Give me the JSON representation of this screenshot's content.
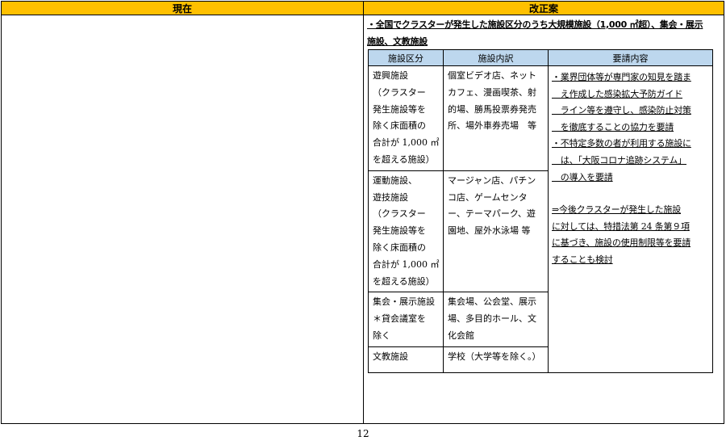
{
  "header": {
    "current_label": "現在",
    "proposal_label": "改正案"
  },
  "proposal": {
    "intro_line1": "・全国でクラスターが発生した施設区分のうち大規模施設（1,000 ㎡超）、集会・展示",
    "intro_line2": "施設、文教施設",
    "table": {
      "columns": [
        "施設区分",
        "施設内訳",
        "要請内容"
      ],
      "rows": [
        {
          "category_lines": [
            "遊興施設",
            "（クラスター",
            "発生施設等を",
            "除く床面積の",
            "合計が 1,000 ㎡",
            "を超える施設）"
          ],
          "detail_lines": [
            "個室ビデオ店、ネット",
            "カフェ、漫画喫茶、射",
            "的場、勝馬投票券発売",
            "所、場外車券売場　等"
          ]
        },
        {
          "category_lines": [
            "運動施設、",
            "遊技施設",
            "（クラスター",
            "発生施設等を",
            "除く床面積の",
            "合計が 1,000 ㎡",
            "を超える施設）"
          ],
          "detail_lines": [
            "マージャン店、パチン",
            "コ店、ゲームセンタ",
            "ー、テーマパーク、遊",
            "園地、屋外水泳場 等"
          ]
        },
        {
          "category_lines": [
            "集会・展示施設",
            "＊貸会議室を",
            "除く"
          ],
          "detail_lines": [
            "集会場、公会堂、展示",
            "場、多目的ホール、文",
            "化会館"
          ]
        },
        {
          "category_lines": [
            "文教施設"
          ],
          "detail_lines": [
            "学校（大学等を除く。）"
          ]
        }
      ],
      "request_lines": [
        "・業界団体等が専門家の知見を踏ま",
        "　え作成した感染拡大予防ガイド",
        "　ライン等を遵守し、感染防止対策",
        "　を徹底することの協力を要請",
        "・不特定多数の者が利用する施設に",
        "　は、「大阪コロナ追跡システム」",
        "　の導入を要請"
      ],
      "request_future_lines": [
        "⇒今後クラスターが発生した施設",
        "に対しては、特措法第 24 条第９項",
        "に基づき、施設の使用制限等を要請",
        "することも検討"
      ]
    }
  },
  "page_number": "12"
}
